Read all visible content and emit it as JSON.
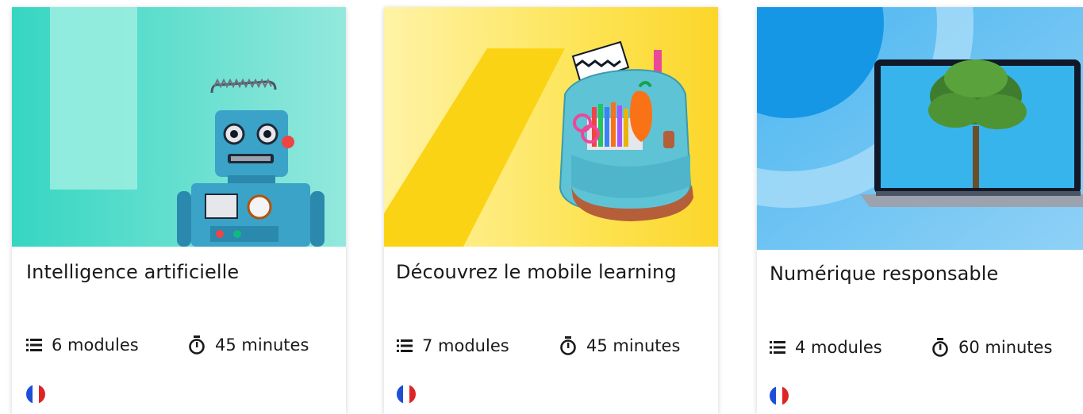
{
  "courses": [
    {
      "title": "Intelligence artificielle",
      "modules": "6 modules",
      "duration": "45 minutes",
      "language_flag": "france-flag-icon",
      "thumbnail": "robot-toy-image",
      "colors": {
        "bg": "#3fd8c4",
        "bg_light": "#9ee9dd"
      }
    },
    {
      "title": "Découvrez le mobile learning",
      "modules": "7 modules",
      "duration": "45 minutes",
      "language_flag": "france-flag-icon",
      "thumbnail": "school-backpack-image",
      "colors": {
        "bg": "#fde047",
        "bg_stripe": "#fbd315"
      }
    },
    {
      "title": "Numérique responsable",
      "modules": "4 modules",
      "duration": "60 minutes",
      "language_flag": "france-flag-icon",
      "thumbnail": "laptop-tree-image",
      "colors": {
        "bg": "#7fcaf3",
        "bg_dark": "#0ea5e9"
      }
    }
  ],
  "flag_colors": {
    "blue": "#1d4ed8",
    "white": "#ffffff",
    "red": "#dc2626"
  }
}
